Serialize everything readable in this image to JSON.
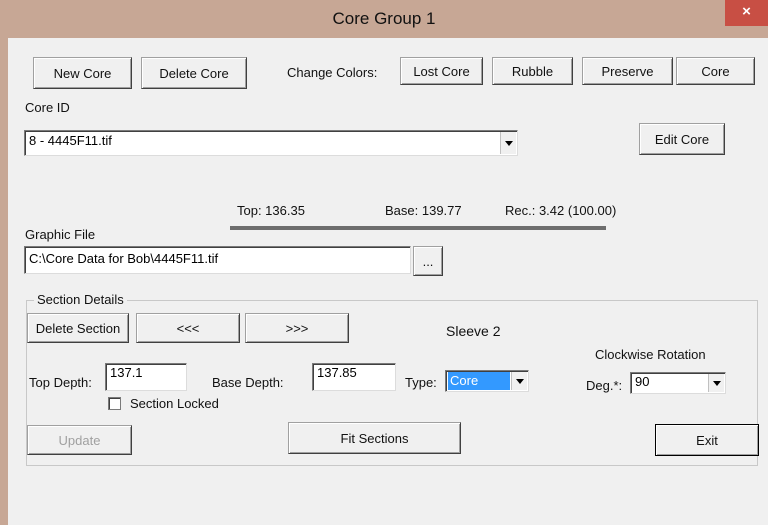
{
  "window": {
    "title": "Core Group 1",
    "close_glyph": "×"
  },
  "toolbar": {
    "new_core": "New Core",
    "delete_core": "Delete Core",
    "change_colors_label": "Change Colors:",
    "color_buttons": [
      "Lost Core",
      "Rubble",
      "Preserve",
      "Core"
    ]
  },
  "core": {
    "id_label": "Core ID",
    "selected": "8 - 4445F11.tif",
    "edit_core": "Edit Core",
    "top": "Top: 136.35",
    "base": "Base: 139.77",
    "rec": "Rec.: 3.42 (100.00)"
  },
  "graphic": {
    "label": "Graphic File",
    "path": "C:\\Core Data for Bob\\4445F11.tif",
    "browse": "..."
  },
  "section": {
    "group_label": "Section Details",
    "delete_section": "Delete Section",
    "prev": "<<<",
    "next": ">>>",
    "sleeve": "Sleeve 2",
    "rotation_title": "Clockwise Rotation",
    "top_depth_label": "Top Depth:",
    "top_depth": "137.1",
    "base_depth_label": "Base Depth:",
    "base_depth": "137.85",
    "type_label": "Type:",
    "type_value": "Core",
    "deg_label": "Deg.*:",
    "deg_value": "90",
    "locked_label": "Section Locked",
    "locked": false
  },
  "footer": {
    "update": "Update",
    "fit_sections": "Fit Sections",
    "exit": "Exit"
  },
  "colors": {
    "frame": "#c7a795",
    "close": "#c84f44",
    "selection": "#3399ff"
  }
}
